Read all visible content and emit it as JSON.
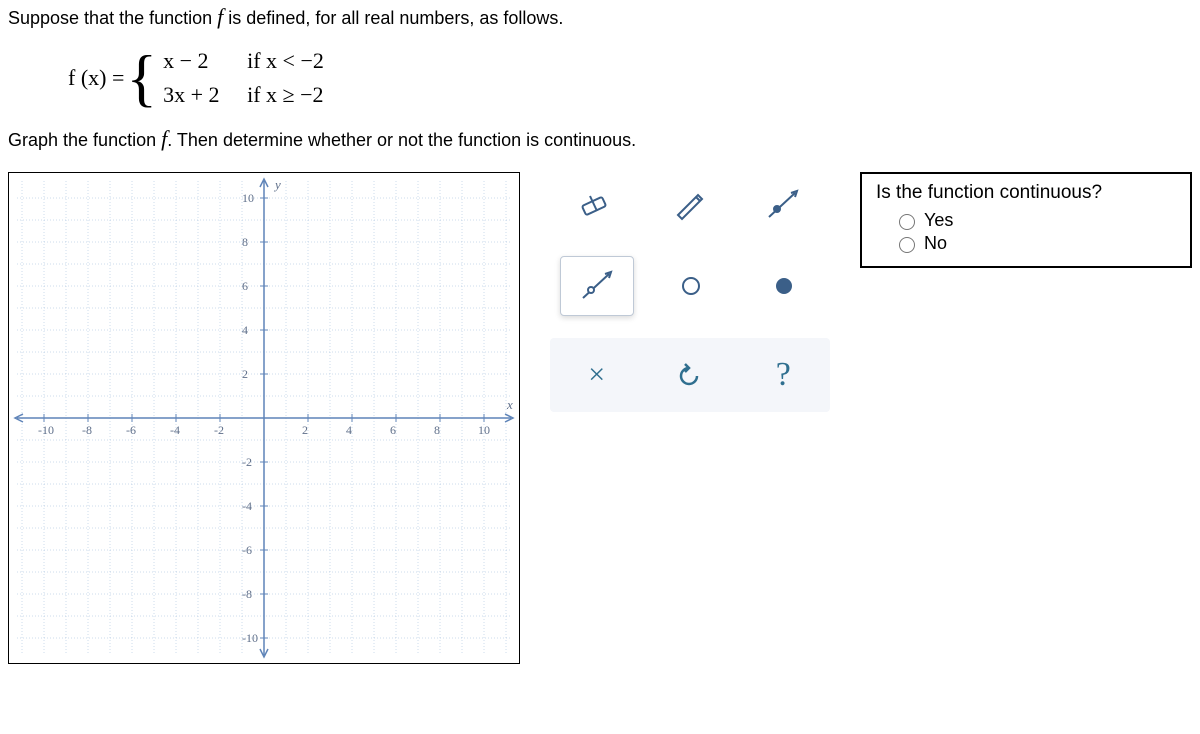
{
  "prompt_line1_a": "Suppose that the function ",
  "prompt_line1_b": "f",
  "prompt_line1_c": " is defined, for all real numbers, as follows.",
  "func_lhs": "f (x) =",
  "piece1_expr": "x − 2",
  "piece1_cond": "if  x < −2",
  "piece2_expr": "3x + 2",
  "piece2_cond": "if  x ≥ −2",
  "prompt_line2_a": "Graph the function ",
  "prompt_line2_b": "f",
  "prompt_line2_c": ". Then determine whether or not the function is continuous.",
  "axis_y_label": "y",
  "axis_x_label": "x",
  "ticks_pos": [
    "2",
    "4",
    "6",
    "8",
    "10"
  ],
  "ticks_neg": [
    "-2",
    "-4",
    "-6",
    "-8",
    "-10"
  ],
  "question": "Is the function continuous?",
  "opt_yes": "Yes",
  "opt_no": "No",
  "tool_names": [
    "eraser-tool",
    "pencil-tool",
    "ray-closed-endpoint-tool",
    "ray-open-endpoint-tool",
    "open-point-tool",
    "closed-point-tool",
    "clear-tool",
    "undo-tool",
    "help-tool"
  ],
  "help_glyph": "?",
  "clear_glyph": "×",
  "undo_glyph": "↺"
}
